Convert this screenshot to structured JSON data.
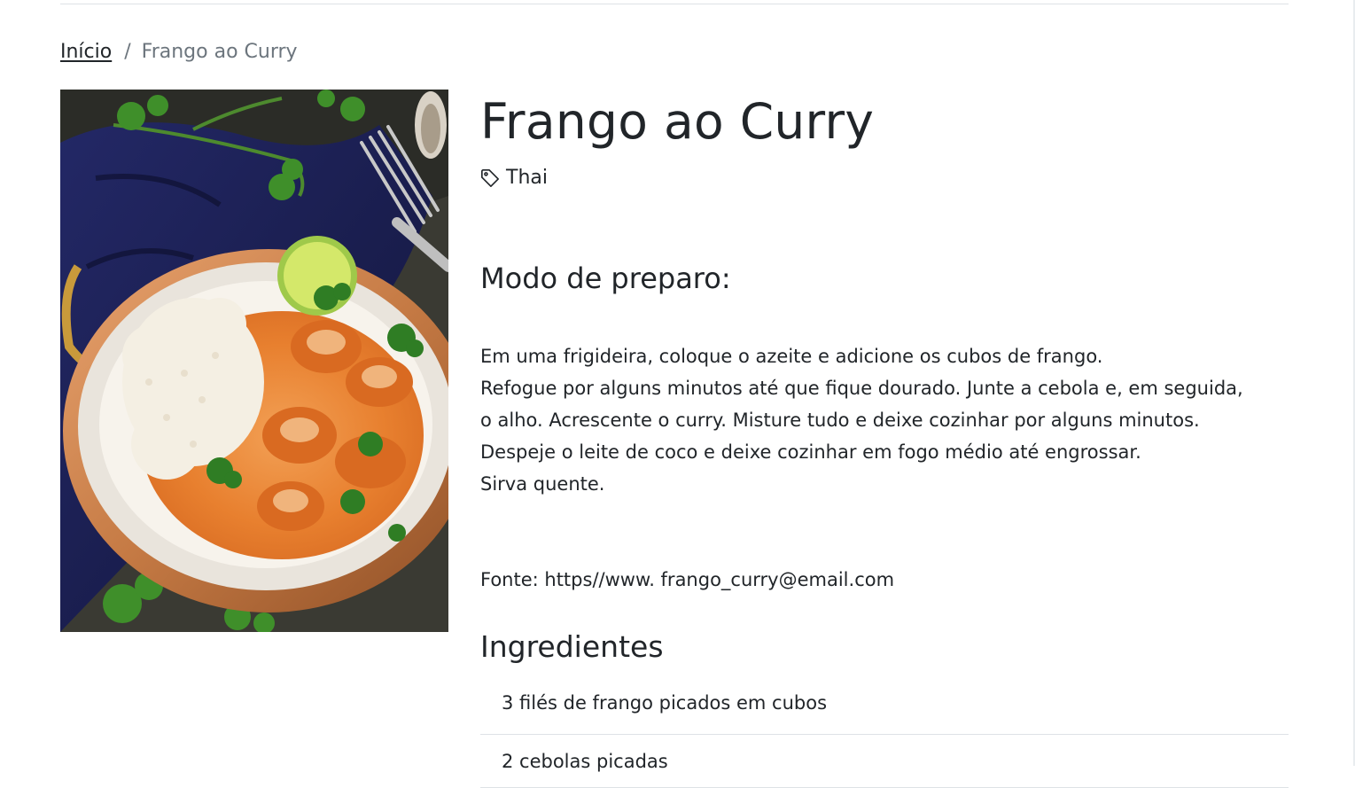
{
  "breadcrumb": {
    "home_label": "Início",
    "separator": "/",
    "current_label": "Frango ao Curry"
  },
  "recipe": {
    "title": "Frango ao Curry",
    "tag": "Thai",
    "tag_icon": "tag-icon",
    "image_icon": "recipe-photo"
  },
  "preparation": {
    "heading": "Modo de preparo:",
    "lines": [
      "Em uma frigideira, coloque o azeite e adicione os cubos de frango.",
      "Refogue por alguns minutos até que fique dourado. Junte a cebola e, em seguida,",
      "o alho. Acrescente o curry. Misture tudo e deixe cozinhar por alguns minutos.",
      "Despeje o leite de coco e deixe cozinhar em fogo médio até engrossar.",
      "Sirva quente."
    ],
    "source": "Fonte: https//www. frango_curry@email.com"
  },
  "ingredients": {
    "heading": "Ingredientes",
    "items": [
      "3 filés de frango picados em cubos",
      "2 cebolas picadas"
    ]
  },
  "colors": {
    "text": "#212529",
    "muted": "#6c757d",
    "divider": "#dee2e6",
    "curry": "#e8802f",
    "napkin": "#1c1f4f",
    "copper": "#c57a44"
  }
}
